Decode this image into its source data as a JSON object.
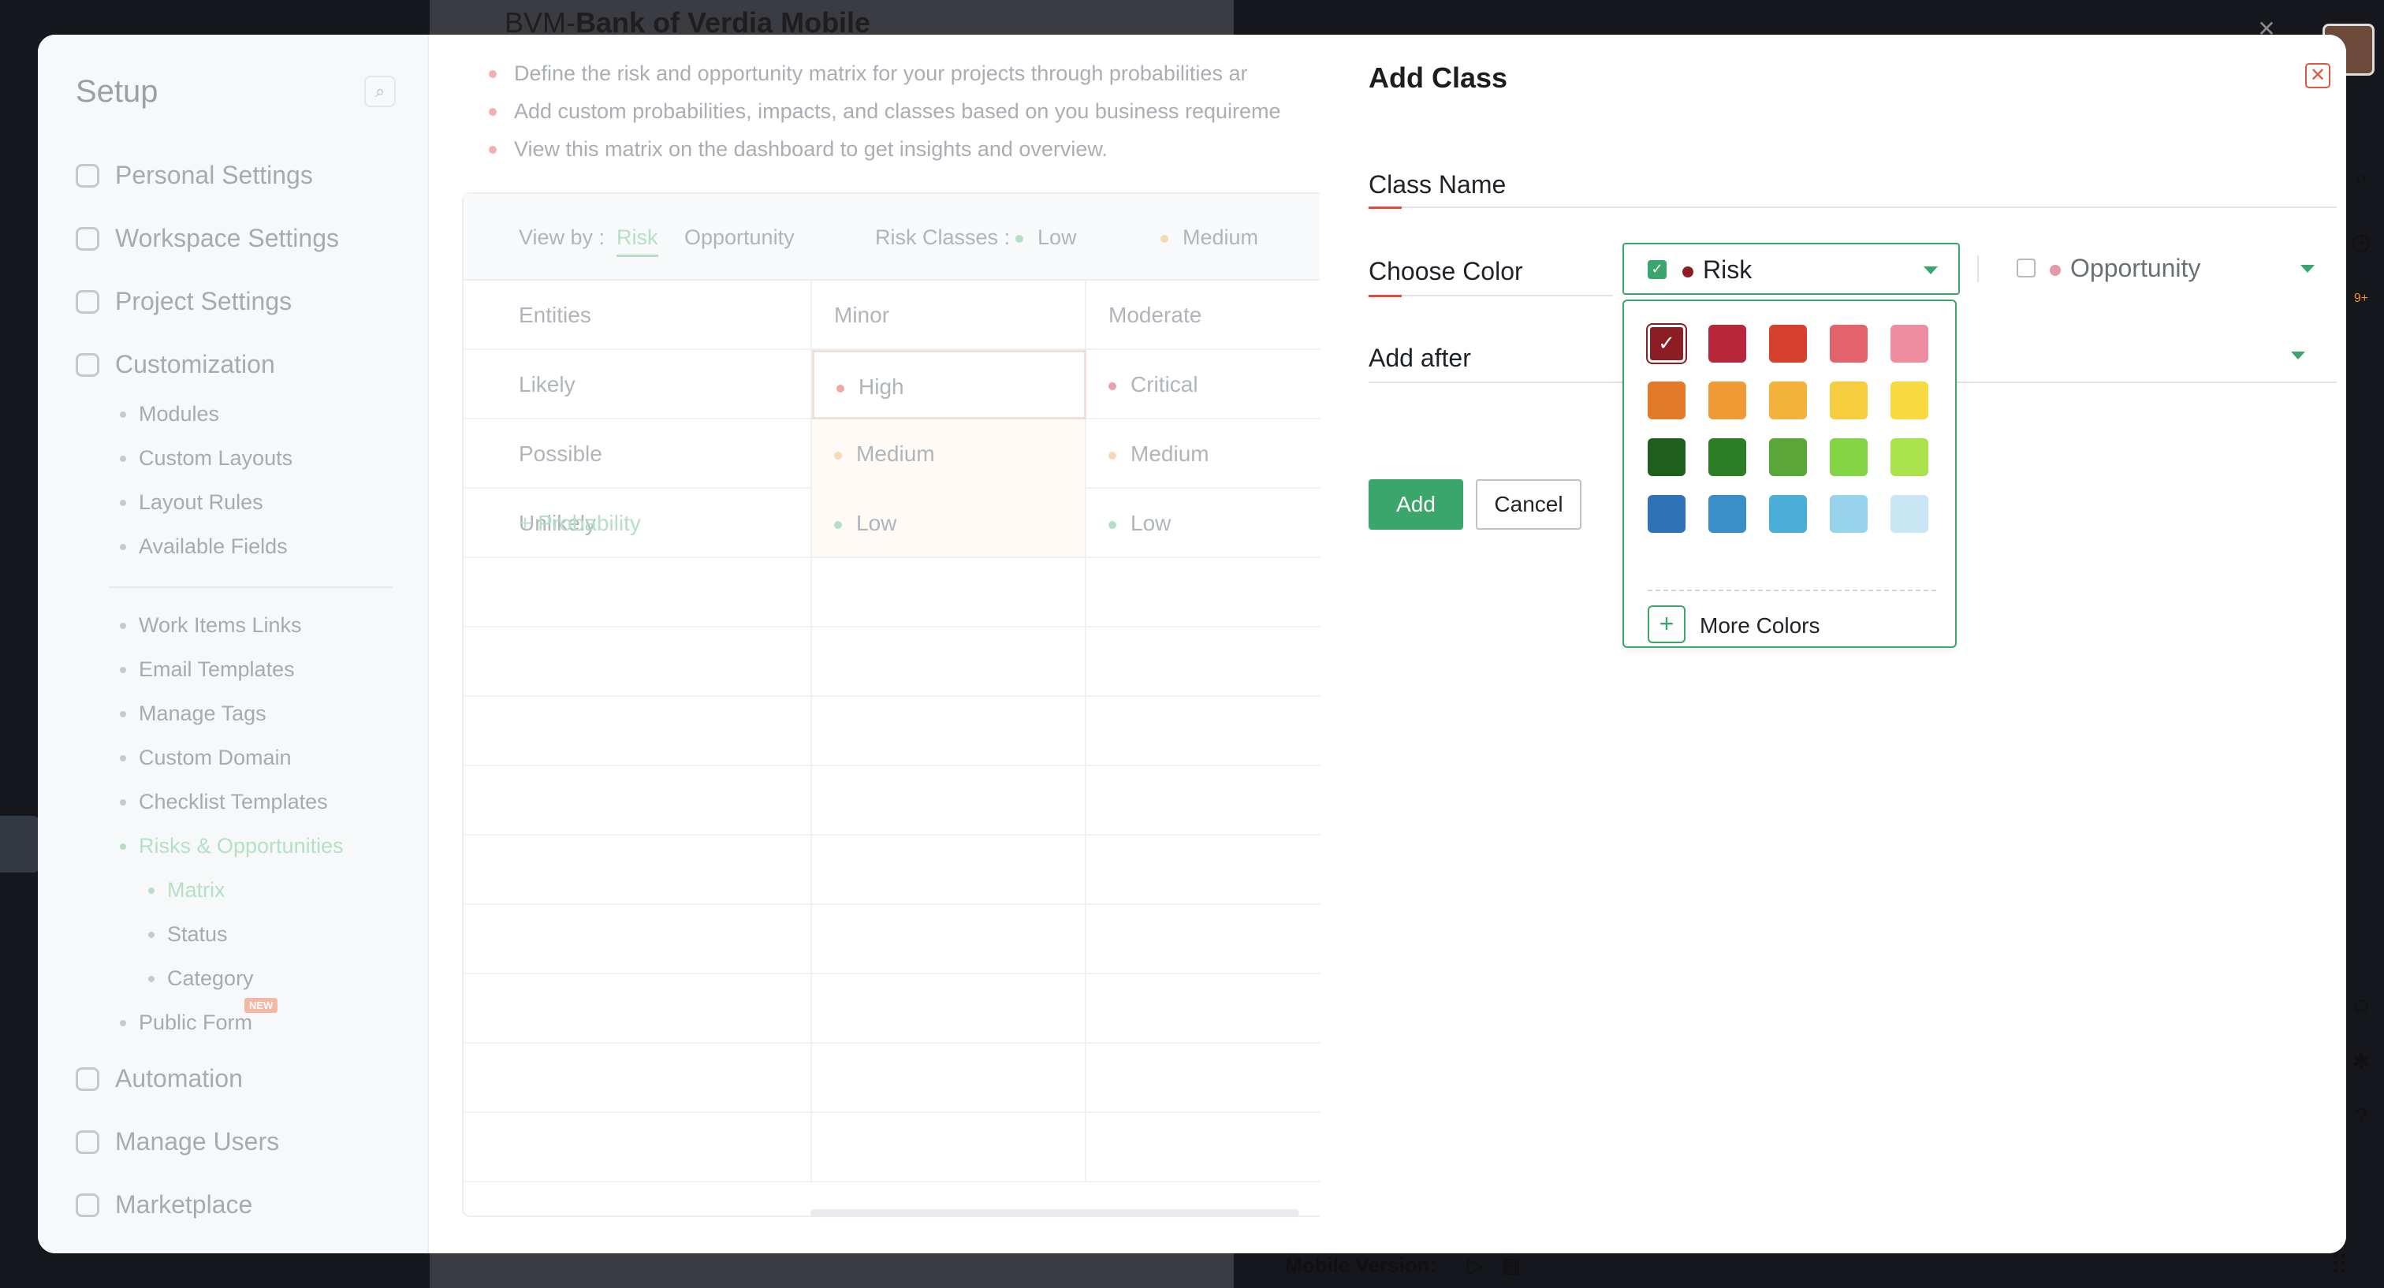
{
  "background": {
    "project_prefix": "BVM-",
    "project_name": "Bank of Verdia Mobile",
    "mobile_version_label": "Mobile Version:",
    "notification_count": "9+"
  },
  "setup": {
    "title": "Setup",
    "nav": {
      "personal_settings": "Personal Settings",
      "workspace_settings": "Workspace Settings",
      "project_settings": "Project Settings",
      "customization": "Customization",
      "modules": "Modules",
      "custom_layouts": "Custom Layouts",
      "layout_rules": "Layout Rules",
      "available_fields": "Available Fields",
      "work_items_links": "Work Items Links",
      "email_templates": "Email Templates",
      "manage_tags": "Manage Tags",
      "custom_domain": "Custom Domain",
      "checklist_templates": "Checklist Templates",
      "risks_opportunities": "Risks & Opportunities",
      "matrix": "Matrix",
      "status": "Status",
      "category": "Category",
      "public_form": "Public Form",
      "new_badge": "NEW",
      "automation": "Automation",
      "manage_users": "Manage Users",
      "marketplace": "Marketplace"
    },
    "info": [
      "Define the risk and opportunity matrix for your projects through probabilities ar",
      "Add custom probabilities, impacts, and classes based on you business requireme",
      "View this matrix on the dashboard to get insights and overview."
    ],
    "matrix": {
      "view_by_label": "View by :",
      "view_risk": "Risk",
      "view_opportunity": "Opportunity",
      "risk_classes_label": "Risk Classes :",
      "class_low": "Low",
      "class_medium": "Medium",
      "headers": [
        "Entities",
        "Minor",
        "Moderate"
      ],
      "rows": [
        {
          "entity": "Likely",
          "minor": "High",
          "moderate": "Critical"
        },
        {
          "entity": "Possible",
          "minor": "Medium",
          "moderate": "Medium"
        },
        {
          "entity": "Unlikely",
          "minor": "Low",
          "moderate": "Low"
        }
      ],
      "add_probability": "+ Probability",
      "dot_colors": {
        "High": "#f3a8a0",
        "Critical": "#e9a0b0",
        "Medium": "#f7d8b7",
        "Low": "#b6e0c6"
      }
    }
  },
  "drawer": {
    "title": "Add Class",
    "class_name_label": "Class Name",
    "choose_color_label": "Choose Color",
    "add_after_label": "Add after",
    "risk_label": "Risk",
    "risk_color": "#8c1d24",
    "opportunity_label": "Opportunity",
    "opportunity_color": "#e39aa6",
    "add_button": "Add",
    "cancel_button": "Cancel",
    "more_colors": "More Colors",
    "palette": [
      [
        "#8c1d24",
        "#b8283a",
        "#d6402f",
        "#e4626b",
        "#ee8da0"
      ],
      [
        "#e27a2a",
        "#f09a35",
        "#f3b33b",
        "#f5cd3e",
        "#f8d93f"
      ],
      [
        "#1f5f1e",
        "#2d7d27",
        "#5aa737",
        "#82d442",
        "#a9e24b"
      ],
      [
        "#2d73b5",
        "#3b8fc8",
        "#4aaed8",
        "#98d3ec",
        "#c8e6f3"
      ]
    ]
  }
}
